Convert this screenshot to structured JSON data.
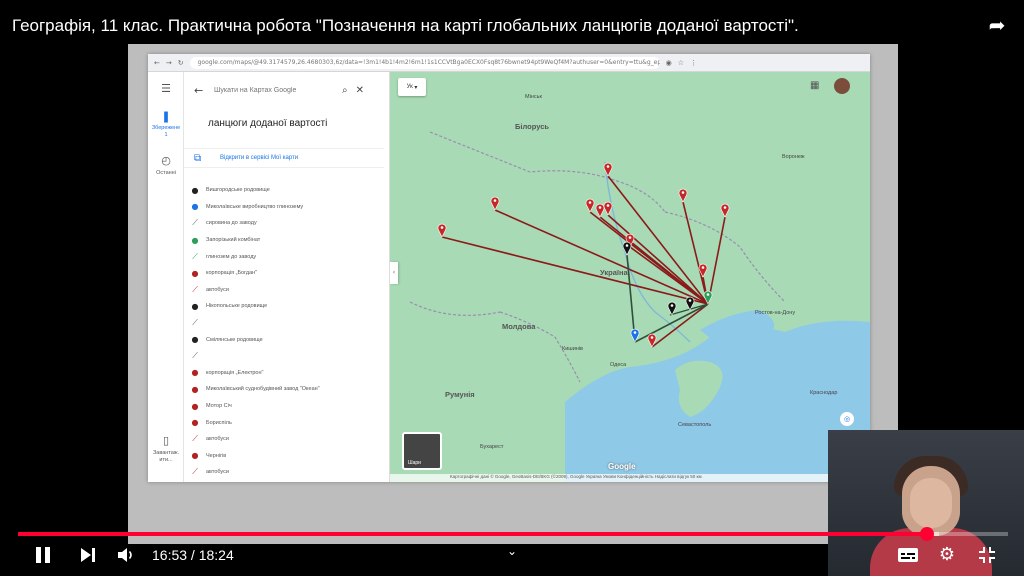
{
  "video": {
    "title": "Географія, 11 клас. Практична робота \"Позначення на карті глобальних ланцюгів доданої вартості\".",
    "time_current": "16:53",
    "time_total": "18:24",
    "time_display": "16:53 / 18:24",
    "progress": 0.918,
    "buffered": 0.93
  },
  "browser": {
    "url": "google.com/maps/@49.3174579,26.4680303,6z/data=!3m1!4b1!4m2!6m1!1s1CCVtBga0ECX0Fsq8t76bwnet94pt9WeQf4M?authuser=0&entry=ttu&g_ep=Eg..."
  },
  "maps": {
    "rail": {
      "saved_label": "Збережене",
      "saved_count": "1",
      "recents_label": "Останні",
      "apps_label": "Завантаж. ити..."
    },
    "search_placeholder": "Шукати на Картах Google",
    "map_title": "ланцюги доданої вартості",
    "open_link": "Відкрити в сервісі Мої карти",
    "layer_label": "Ук",
    "thumb_label": "Шари",
    "footer": "Картографічні дані © Google, GeoBasis-DE/BKG (©2009), Google    Україна    Умови    Конфіденційність    Надіслати відгук    50 км",
    "google_logo": "Google",
    "legend": [
      {
        "label": "Вишгородське родовище",
        "color": "#222222",
        "icon": "pin-icon"
      },
      {
        "label": "Миколаївське виробництво глинозему",
        "color": "#1a73e8",
        "icon": "pin-icon"
      },
      {
        "label": "сировина до заводу",
        "color": "#555555",
        "icon": "route-icon"
      },
      {
        "label": "Запорізький комбінат",
        "color": "#2e9e5b",
        "icon": "pin-icon"
      },
      {
        "label": "глинозем до заводу",
        "color": "#2e9e5b",
        "icon": "route-icon"
      },
      {
        "label": "корпорація „Богдан\"",
        "color": "#b22222",
        "icon": "pin-icon"
      },
      {
        "label": "автобуси",
        "color": "#b22222",
        "icon": "route-icon"
      },
      {
        "label": "Нікопольське родовище",
        "color": "#222222",
        "icon": "pin-icon"
      },
      {
        "label": "",
        "color": "#555555",
        "icon": "route-icon"
      },
      {
        "label": "Смілянське родовище",
        "color": "#222222",
        "icon": "pin-icon"
      },
      {
        "label": "",
        "color": "#555555",
        "icon": "route-icon"
      },
      {
        "label": "корпорація „Електрон\"",
        "color": "#b22222",
        "icon": "pin-icon"
      },
      {
        "label": "Миколаївський суднобудівний завод \"Океан\"",
        "color": "#b22222",
        "icon": "pin-icon"
      },
      {
        "label": "Мотор Січ",
        "color": "#b22222",
        "icon": "pin-icon"
      },
      {
        "label": "Бориспіль",
        "color": "#b22222",
        "icon": "pin-icon"
      },
      {
        "label": "автобуси",
        "color": "#b22222",
        "icon": "route-icon"
      },
      {
        "label": "Чернігів",
        "color": "#b22222",
        "icon": "pin-icon"
      },
      {
        "label": "автобуси",
        "color": "#b22222",
        "icon": "route-icon"
      }
    ],
    "countries": [
      {
        "name": "Білорусь",
        "cls": "c1"
      },
      {
        "name": "Україна",
        "cls": "c2"
      },
      {
        "name": "Молдова",
        "cls": "c3"
      },
      {
        "name": "Румунія",
        "cls": "c4"
      }
    ],
    "cities": [
      {
        "name": "Мінськ",
        "cls": "p1"
      },
      {
        "name": "Воронеж",
        "cls": "p2"
      },
      {
        "name": "Кишинів",
        "cls": "p3"
      },
      {
        "name": "Одеса",
        "cls": "p4"
      },
      {
        "name": "Ростов-на-Дону",
        "cls": "p5"
      },
      {
        "name": "Краснодар",
        "cls": "p6"
      },
      {
        "name": "Севастополь",
        "cls": "p7"
      },
      {
        "name": "Бухарест",
        "cls": "p8"
      }
    ]
  },
  "colors": {
    "progress": "#ff0033",
    "route_red": "#8b1a1a",
    "route_dark": "#2f4f3a",
    "pin_red": "#c62828",
    "pin_black": "#111111",
    "pin_green": "#2e9e5b",
    "pin_blue": "#1a73e8",
    "sea": "#8fc9e8",
    "land": "#a8dab5"
  }
}
